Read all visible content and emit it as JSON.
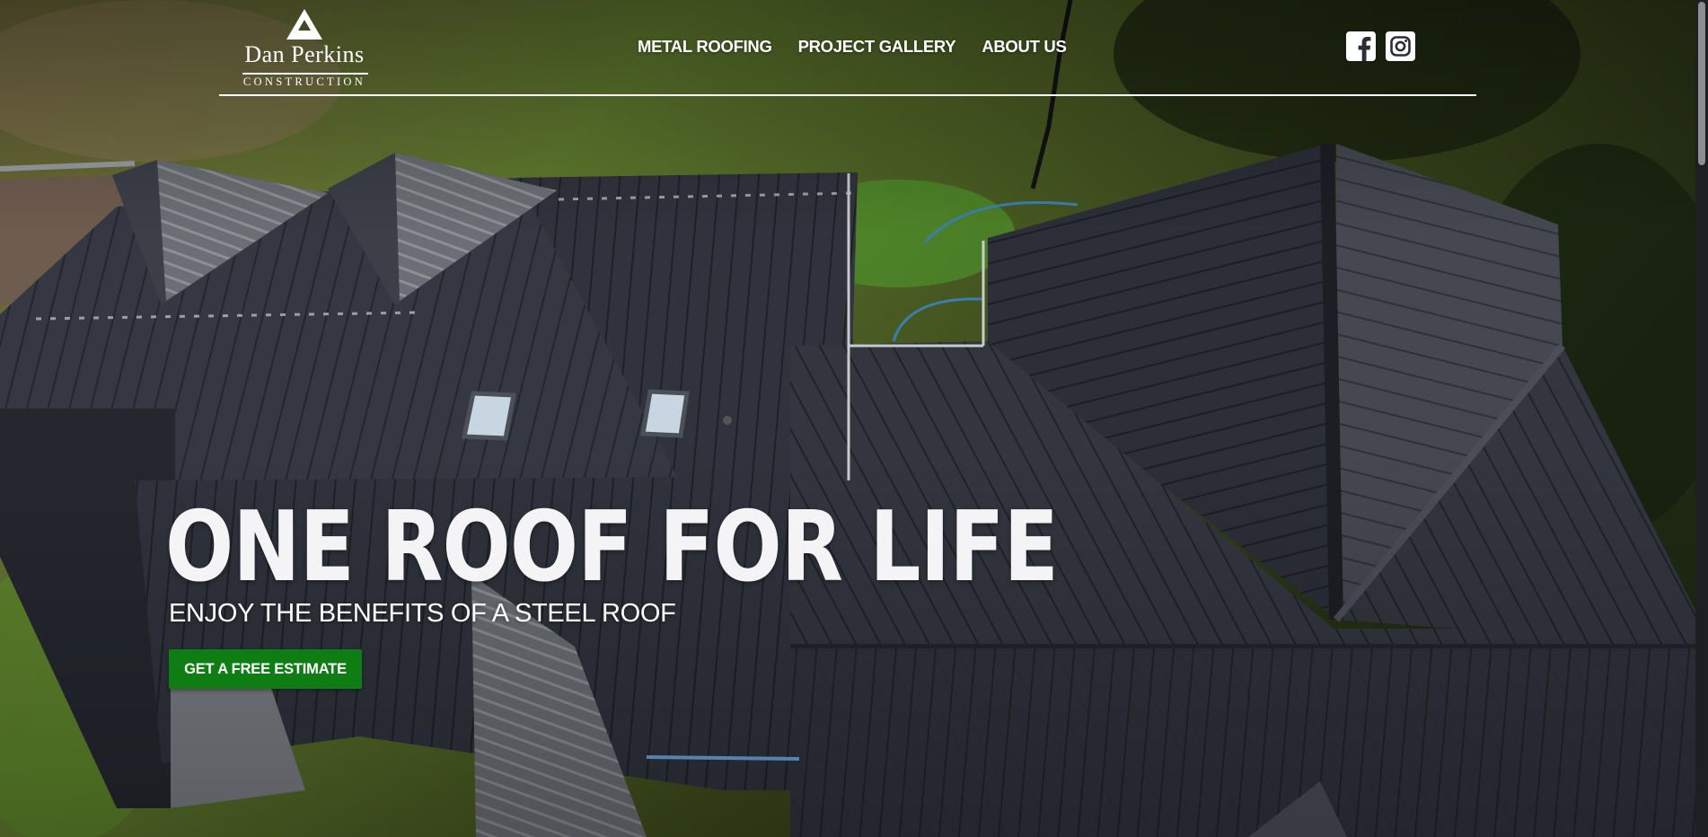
{
  "brand": {
    "name": "Dan Perkins",
    "subtitle": "Construction"
  },
  "nav": {
    "items": [
      {
        "label": "METAL ROOFING"
      },
      {
        "label": "PROJECT GALLERY"
      },
      {
        "label": "ABOUT US"
      }
    ]
  },
  "social": {
    "facebook_icon": "facebook-icon",
    "instagram_icon": "instagram-icon"
  },
  "hero": {
    "headline": "ONE ROOF FOR LIFE",
    "subheadline": "ENJOY THE BENEFITS OF A STEEL ROOF",
    "cta_label": "GET A FREE ESTIMATE"
  },
  "colors": {
    "cta": "#0e7d13",
    "roof": "#333741",
    "grass": "#5d7a2c",
    "text": "#ffffff"
  }
}
